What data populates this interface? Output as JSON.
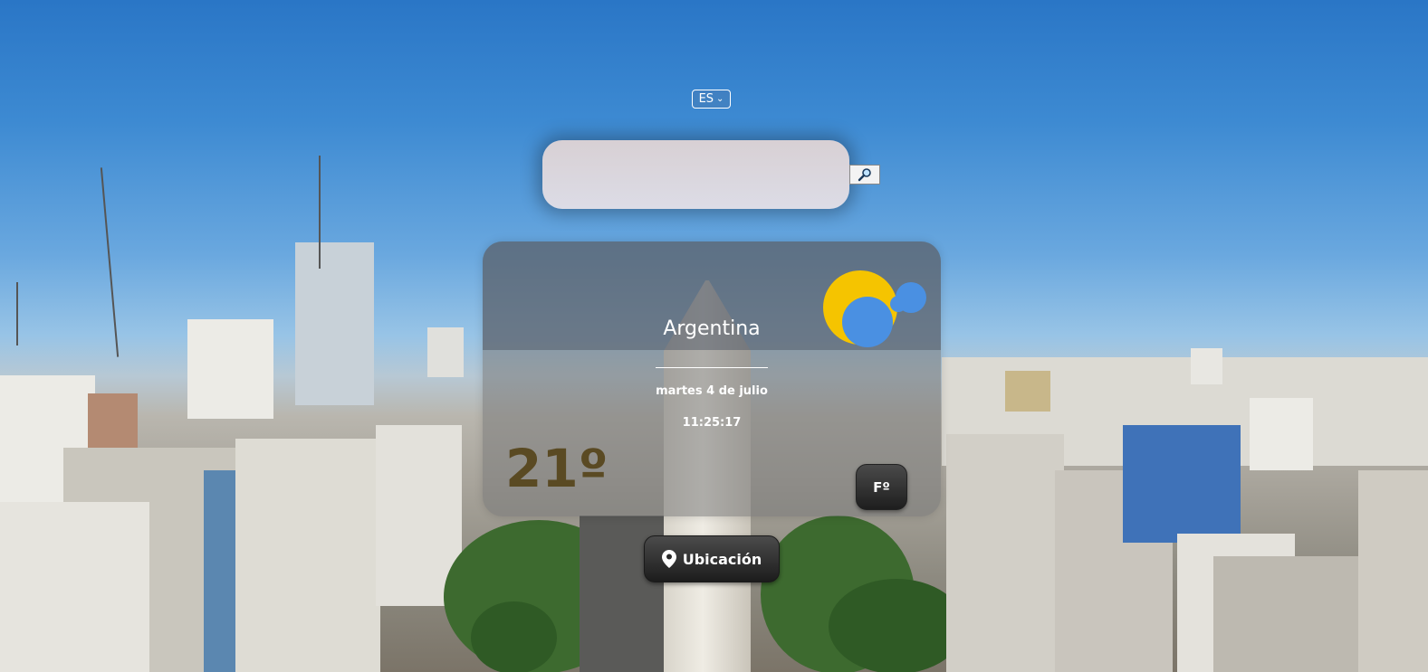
{
  "language_selector": {
    "selected": "ES",
    "chevron_icon": "chevron-down-icon"
  },
  "search": {
    "value": "",
    "placeholder": "",
    "button_icon": "magnifier-icon"
  },
  "weather_card": {
    "location": "Argentina",
    "date": "martes 4 de julio",
    "time": "11:25:17",
    "temperature": "21º",
    "unit_toggle_label": "Fº",
    "condition_icon": "partly-cloudy-icon",
    "colors": {
      "sun": "#f5c400",
      "cloud": "#4a90e2",
      "temperature": "#5a4a23"
    }
  },
  "location_button": {
    "label": "Ubicación",
    "icon": "map-pin-icon"
  }
}
